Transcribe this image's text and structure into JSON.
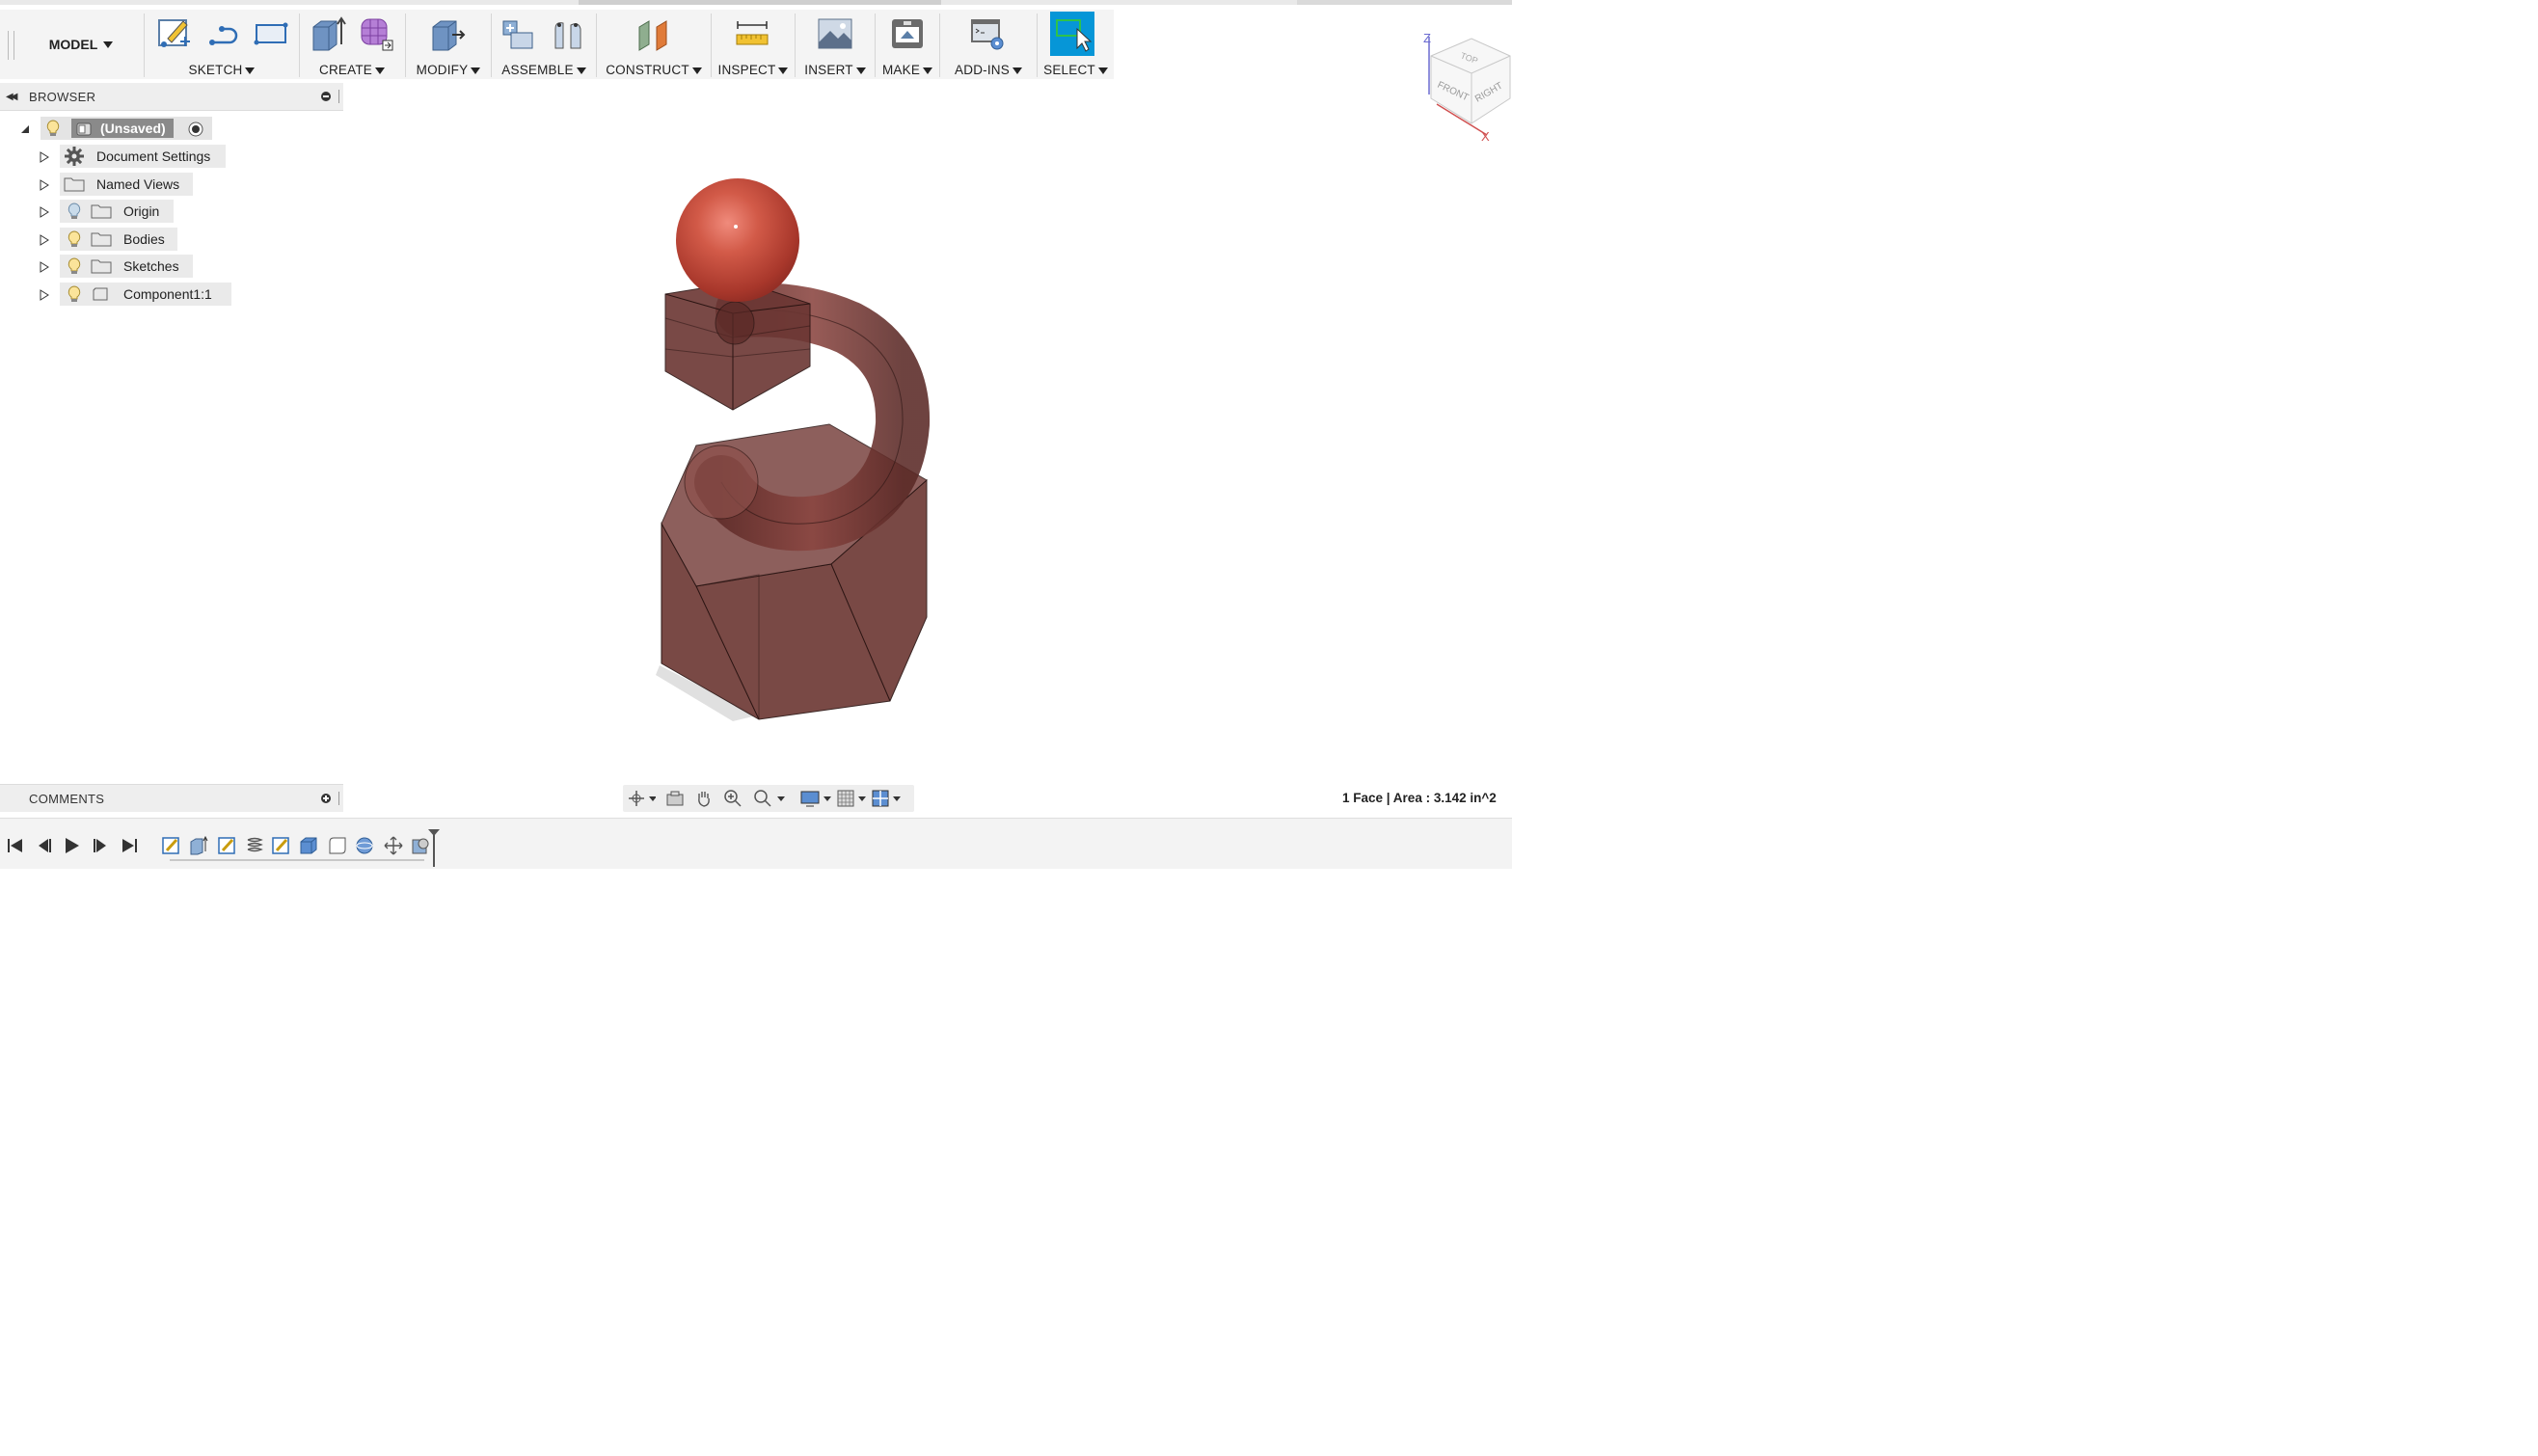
{
  "toolbar": {
    "workspace": "MODEL",
    "groups": {
      "sketch": "SKETCH",
      "create": "CREATE",
      "modify": "MODIFY",
      "assemble": "ASSEMBLE",
      "construct": "CONSTRUCT",
      "inspect": "INSPECT",
      "insert": "INSERT",
      "make": "MAKE",
      "addins": "ADD-INS",
      "select": "SELECT"
    }
  },
  "browser": {
    "title": "BROWSER",
    "root": "(Unsaved)",
    "items": [
      {
        "label": "Document Settings",
        "icon": "gear-icon"
      },
      {
        "label": "Named Views",
        "icon": "folder-icon"
      },
      {
        "label": "Origin",
        "icon": "folder-icon"
      },
      {
        "label": "Bodies",
        "icon": "folder-icon"
      },
      {
        "label": "Sketches",
        "icon": "folder-icon"
      },
      {
        "label": "Component1:1",
        "icon": "component-icon"
      }
    ]
  },
  "comments": {
    "title": "COMMENTS"
  },
  "status": {
    "selection": "1 Face | Area : 3.142 in^2"
  },
  "viewcube": {
    "top": "TOP",
    "front": "FRONT",
    "right": "RIGHT",
    "z": "Z",
    "x": "X"
  },
  "colors": {
    "accent": "#0696d7",
    "body": "#6e3a36",
    "sphere": "#c0392b"
  }
}
